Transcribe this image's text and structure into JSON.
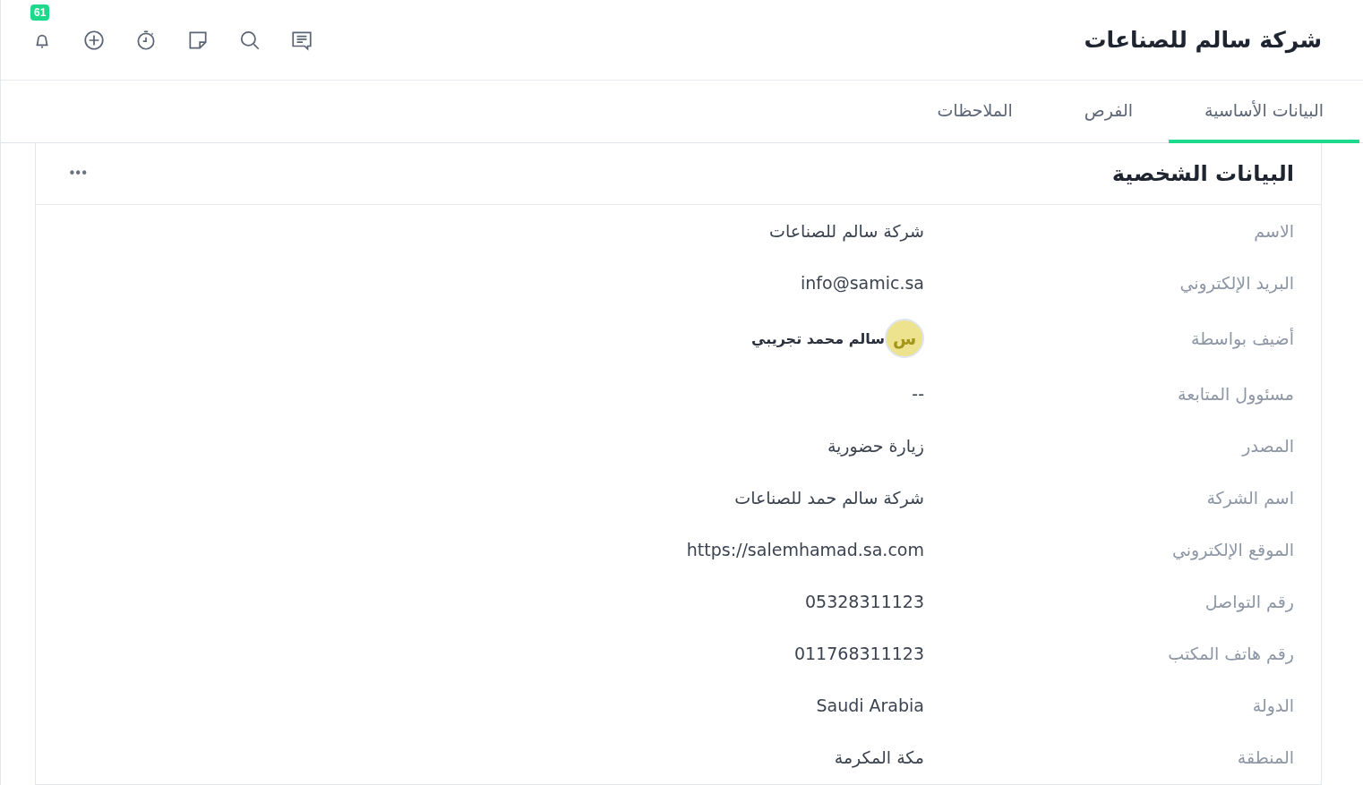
{
  "header": {
    "title": "شركة سالم للصناعات",
    "notification_count": "61"
  },
  "tabs": [
    {
      "label": "البيانات الأساسية",
      "selected": true
    },
    {
      "label": "الفرص",
      "selected": false
    },
    {
      "label": "الملاحظات",
      "selected": false
    }
  ],
  "card": {
    "title": "البيانات الشخصية",
    "menu": "•••",
    "rows": [
      {
        "kind": "text",
        "label": "الاسم",
        "value": "شركة سالم للصناعات"
      },
      {
        "kind": "text",
        "label": "البريد الإلكتروني",
        "value": "info@samic.sa"
      },
      {
        "kind": "user",
        "label": "أضيف بواسطة",
        "initial": "س",
        "value": "سالم محمد تجريبي"
      },
      {
        "kind": "text",
        "label": "مسئوول المتابعة",
        "value": "--"
      },
      {
        "kind": "text",
        "label": "المصدر",
        "value": "زيارة حضورية"
      },
      {
        "kind": "text",
        "label": "اسم الشركة",
        "value": "شركة سالم حمد للصناعات"
      },
      {
        "kind": "text",
        "label": "الموقع الإلكتروني",
        "value": "https://salemhamad.sa.com"
      },
      {
        "kind": "text",
        "label": "رقم التواصل",
        "value": "05328311123"
      },
      {
        "kind": "text",
        "label": "رقم هاتف المكتب",
        "value": "011768311123"
      },
      {
        "kind": "text",
        "label": "الدولة",
        "value": "Saudi Arabia"
      },
      {
        "kind": "text",
        "label": "المنطقة",
        "value": "مكة المكرمة"
      }
    ]
  }
}
